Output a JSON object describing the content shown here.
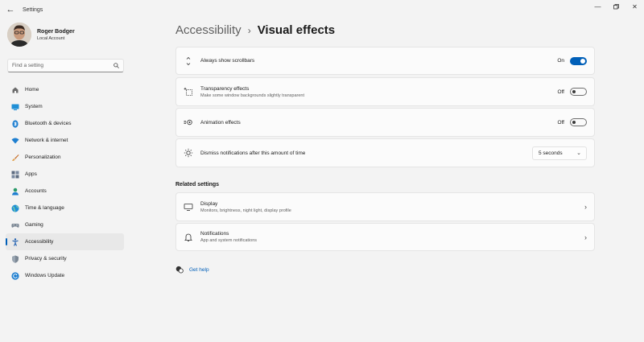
{
  "app": {
    "title": "Settings"
  },
  "profile": {
    "name": "Roger Bodger",
    "account": "Local Account"
  },
  "search": {
    "placeholder": "Find a setting"
  },
  "nav": [
    {
      "label": "Home",
      "icon": "home-icon"
    },
    {
      "label": "System",
      "icon": "system-icon"
    },
    {
      "label": "Bluetooth & devices",
      "icon": "bluetooth-icon"
    },
    {
      "label": "Network & internet",
      "icon": "wifi-icon"
    },
    {
      "label": "Personalization",
      "icon": "brush-icon"
    },
    {
      "label": "Apps",
      "icon": "apps-icon"
    },
    {
      "label": "Accounts",
      "icon": "accounts-icon"
    },
    {
      "label": "Time & language",
      "icon": "globe-icon"
    },
    {
      "label": "Gaming",
      "icon": "controller-icon"
    },
    {
      "label": "Accessibility",
      "icon": "accessibility-icon",
      "active": true
    },
    {
      "label": "Privacy & security",
      "icon": "shield-icon"
    },
    {
      "label": "Windows Update",
      "icon": "update-icon"
    }
  ],
  "breadcrumb": {
    "parent": "Accessibility",
    "separator": "›",
    "current": "Visual effects"
  },
  "settings": {
    "scrollbars": {
      "title": "Always show scrollbars",
      "state": "On",
      "on": true
    },
    "transparency": {
      "title": "Transparency effects",
      "subtitle": "Make some window backgrounds slightly transparent",
      "state": "Off",
      "on": false
    },
    "animation": {
      "title": "Animation effects",
      "state": "Off",
      "on": false
    },
    "notifications_timeout": {
      "title": "Dismiss notifications after this amount of time",
      "value": "5 seconds"
    }
  },
  "related": {
    "heading": "Related settings",
    "display": {
      "title": "Display",
      "subtitle": "Monitors, brightness, night light, display profile"
    },
    "notifications": {
      "title": "Notifications",
      "subtitle": "App and system notifications"
    }
  },
  "help": {
    "label": "Get help"
  },
  "colors": {
    "accent": "#005fb8",
    "background": "#f3f3f3",
    "card": "#fbfbfb"
  }
}
